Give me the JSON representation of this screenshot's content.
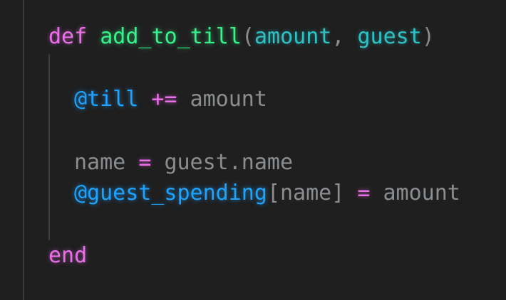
{
  "code": {
    "line_def": {
      "keyword": "def",
      "function_name": "add_to_till",
      "open_paren": "(",
      "param1": "amount",
      "comma": ", ",
      "param2": "guest",
      "close_paren": ")"
    },
    "line_till": {
      "ivar": "@till",
      "operator": "+=",
      "value": "amount"
    },
    "line_name": {
      "var": "name",
      "operator": "=",
      "value": "guest.name"
    },
    "line_spending": {
      "ivar": "@guest_spending",
      "index": "[name]",
      "operator": "=",
      "value": "amount"
    },
    "line_end": {
      "keyword": "end"
    }
  },
  "colors": {
    "background": "#1f1f1f",
    "keyword": "#ea6fe9",
    "function_name": "#33f58b",
    "parameter": "#2ec2c5",
    "instance_variable": "#1ea3ff",
    "plain_text": "#8b8e91"
  }
}
